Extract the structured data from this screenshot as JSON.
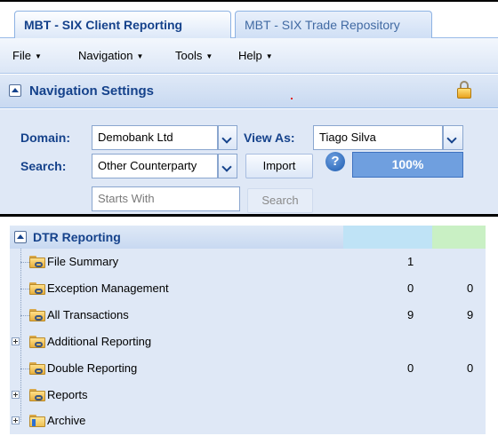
{
  "tabs": [
    {
      "label": "MBT - SIX Client Reporting",
      "active": true
    },
    {
      "label": "MBT - SIX Trade Repository",
      "active": false
    }
  ],
  "menu": [
    {
      "label": "File"
    },
    {
      "label": "Navigation"
    },
    {
      "label": "Tools"
    },
    {
      "label": "Help"
    }
  ],
  "nav_settings": {
    "title": "Navigation Settings",
    "domain_label": "Domain:",
    "domain_value": "Demobank Ltd",
    "view_as_label": "View As:",
    "view_as_value": "Tiago Silva",
    "search_label": "Search:",
    "search_type_value": "Other Counterparty",
    "import_label": "Import",
    "help_glyph": "?",
    "progress_text": "100%",
    "progress_fraction": 1.0,
    "starts_with_placeholder": "Starts With",
    "search_button_label": "Search"
  },
  "tree": {
    "title": "DTR Reporting",
    "items": [
      {
        "label": "File Summary",
        "col1": "1",
        "col2": "",
        "expandable": false,
        "icon": "folder-link-icon"
      },
      {
        "label": "Exception Management",
        "col1": "0",
        "col2": "0",
        "expandable": false,
        "icon": "folder-link-icon"
      },
      {
        "label": "All Transactions",
        "col1": "9",
        "col2": "9",
        "expandable": false,
        "icon": "folder-link-icon"
      },
      {
        "label": "Additional Reporting",
        "col1": "",
        "col2": "",
        "expandable": true,
        "icon": "folder-link-icon"
      },
      {
        "label": "Double Reporting",
        "col1": "0",
        "col2": "0",
        "expandable": false,
        "icon": "folder-link-icon"
      },
      {
        "label": "Reports",
        "col1": "",
        "col2": "",
        "expandable": true,
        "icon": "folder-link-icon"
      },
      {
        "label": "Archive",
        "col1": "",
        "col2": "",
        "expandable": true,
        "icon": "archive-folder-icon"
      }
    ]
  },
  "colors": {
    "header_text": "#15428b",
    "panel_bg": "#dfe8f6",
    "progress_bg": "#6f9fdf",
    "col_stripe_1": "#bfe3f6",
    "col_stripe_2": "#c9f0c4"
  }
}
